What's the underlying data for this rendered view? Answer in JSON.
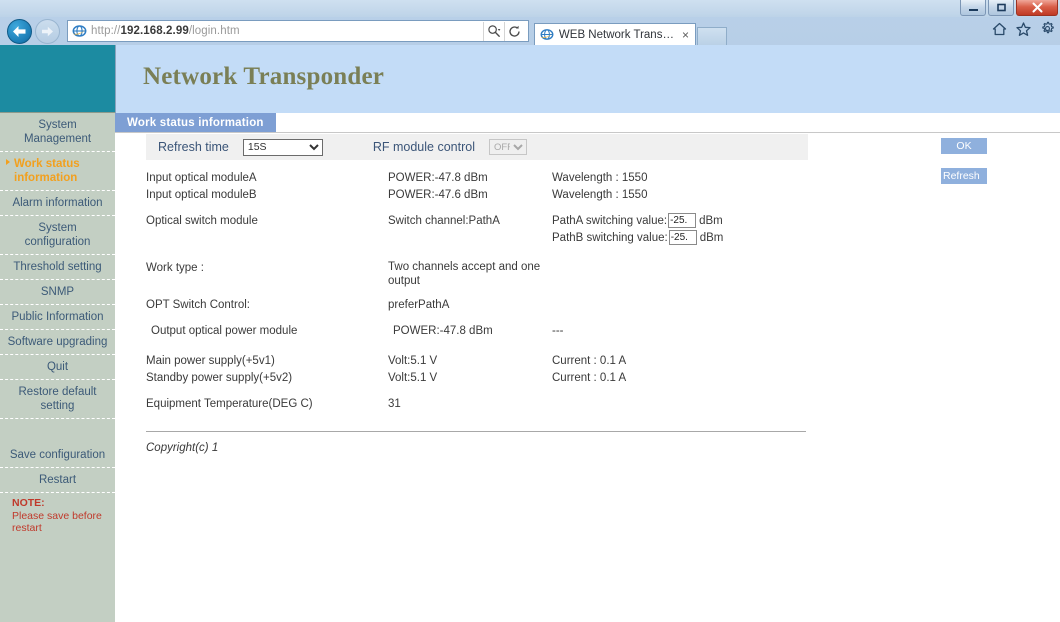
{
  "browser": {
    "url_prefix": "http://",
    "url_host": "192.168.2.99",
    "url_path": "/login.htm",
    "url_full": "http://192.168.2.99/login.htm",
    "tab_title": "WEB Network Transpon...",
    "tab_close_glyph": "×",
    "search_glyph": "⌕",
    "dropdown_glyph": "▾",
    "refresh_glyph": "↻",
    "minimize_glyph": "—",
    "maximize_glyph": "❐",
    "close_glyph": "✕"
  },
  "page": {
    "banner_title": "Network Transponder",
    "tab_label": "Work status information",
    "copyright": "Copyright(c) 1"
  },
  "sidebar": {
    "items": [
      {
        "label": "System Management",
        "active": false
      },
      {
        "label": "Work status information",
        "active": true
      },
      {
        "label": "Alarm information",
        "active": false
      },
      {
        "label": "System configuration",
        "active": false
      },
      {
        "label": "Threshold setting",
        "active": false
      },
      {
        "label": "SNMP",
        "active": false
      },
      {
        "label": "Public Information",
        "active": false
      },
      {
        "label": "Software upgrading",
        "active": false
      },
      {
        "label": "Quit",
        "active": false
      },
      {
        "label": "Restore default setting",
        "active": false
      }
    ],
    "items2": [
      {
        "label": "Save configuration",
        "active": false
      },
      {
        "label": "Restart",
        "active": false
      }
    ],
    "note_title": "NOTE:",
    "note_text": "Please save before restart"
  },
  "controls": {
    "refresh_time_label": "Refresh time",
    "refresh_time_value": "15S",
    "refresh_time_options": [
      "15S"
    ],
    "rf_module_label": "RF module control",
    "rf_module_value": "OFF",
    "rf_module_options": [
      "OFF"
    ],
    "ok_label": "OK",
    "refresh_label": "Refresh"
  },
  "status": {
    "input_a": {
      "name": "Input optical moduleA",
      "power": "POWER:-47.8 dBm",
      "extra": "Wavelength : 1550"
    },
    "input_b": {
      "name": "Input optical moduleB",
      "power": "POWER:-47.6 dBm",
      "extra": "Wavelength : 1550"
    },
    "optical_switch": {
      "name": "Optical switch module",
      "channel": "Switch channel:PathA"
    },
    "patha_switch": {
      "label": "PathA switching value:",
      "value": "-25.",
      "unit": "dBm"
    },
    "pathb_switch": {
      "label": "PathB switching value:",
      "value": "-25.",
      "unit": "dBm"
    },
    "work_type": {
      "name": "Work type :",
      "value": "Two channels accept and one output"
    },
    "opt_switch_control": {
      "name": "OPT Switch Control:",
      "value": "preferPathA"
    },
    "output_power": {
      "name": "Output optical power module",
      "value": "POWER:-47.8 dBm",
      "extra": "---"
    },
    "main_power": {
      "name": "Main power supply(+5v1)",
      "volt": "Volt:5.1 V",
      "current": "Current : 0.1 A"
    },
    "standby_power": {
      "name": "Standby power supply(+5v2)",
      "volt": "Volt:5.1 V",
      "current": "Current : 0.1 A"
    },
    "temperature": {
      "name": "Equipment Temperature(DEG C)",
      "value": "31"
    }
  }
}
